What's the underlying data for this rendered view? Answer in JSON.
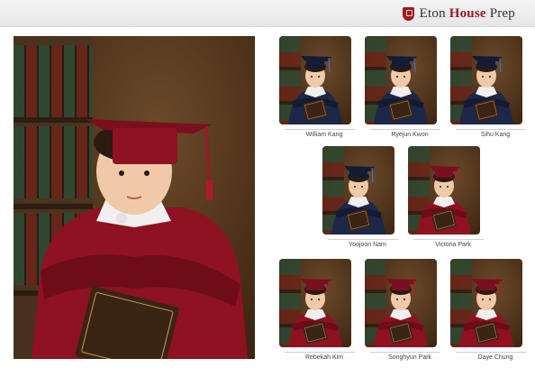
{
  "header": {
    "brand_part1": "Eton ",
    "brand_part2": "House",
    "brand_part3": " Prep",
    "crest_icon": "school-crest-icon",
    "accent_color": "#9b1b26"
  },
  "main_photo": {
    "subject": "graduate-portrait",
    "gown_color": "#a0162a"
  },
  "students": [
    {
      "name": "William Kang",
      "gown": "navy"
    },
    {
      "name": "Ryejun Kwon",
      "gown": "navy"
    },
    {
      "name": "Sihu Kang",
      "gown": "navy"
    },
    {
      "name": "Yoojoon Nam",
      "gown": "navy"
    },
    {
      "name": "Victoria Park",
      "gown": "crimson"
    },
    {
      "name": "Rebekah Kim",
      "gown": "crimson"
    },
    {
      "name": "Songhyun Park",
      "gown": "crimson"
    },
    {
      "name": "Daye Chung",
      "gown": "crimson"
    }
  ]
}
